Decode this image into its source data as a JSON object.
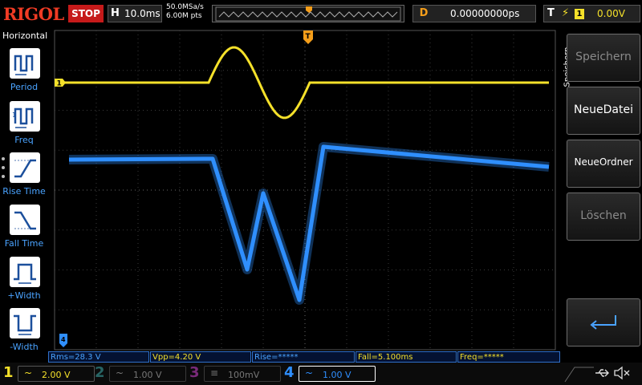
{
  "topbar": {
    "logo": "RIGOL",
    "run_state": "STOP",
    "horizontal_letter": "H",
    "timebase": "10.0ms",
    "sample_rate": "50.0MSa/s",
    "memory_depth": "6.00M pts",
    "delay_letter": "D",
    "delay": "0.00000000ps",
    "trigger_letter": "T",
    "trigger_edge": "⚡",
    "trigger_source": "1",
    "trigger_level": "0.00V"
  },
  "left_menu": {
    "title": "Horizontal",
    "items": [
      {
        "label": "Period",
        "icon": "period-icon"
      },
      {
        "label": "Freq",
        "icon": "freq-icon"
      },
      {
        "label": "Rise Time",
        "icon": "rise-time-icon"
      },
      {
        "label": "Fall Time",
        "icon": "fall-time-icon"
      },
      {
        "label": "+Width",
        "icon": "positive-width-icon"
      },
      {
        "label": "-Width",
        "icon": "negative-width-icon"
      }
    ]
  },
  "right_menu": {
    "tab": "Speichern",
    "buttons": [
      {
        "label": "Speichern",
        "enabled": false
      },
      {
        "label": "NeueDatei",
        "enabled": true
      },
      {
        "label": "NeueOrdner",
        "enabled": true
      },
      {
        "label": "Löschen",
        "enabled": false
      }
    ],
    "return_icon": "return-arrow-icon"
  },
  "markers": {
    "ch1": "1",
    "trigger_pos": "T",
    "ch4": "4"
  },
  "measurements": [
    {
      "text": "Rms=28.3 V",
      "color": "blue"
    },
    {
      "text": "Vpp=4.20 V",
      "color": "yellow"
    },
    {
      "text": "Rise=*****",
      "color": "blue"
    },
    {
      "text": "Fall=5.100ms",
      "color": "yellow"
    },
    {
      "text": "Freq=*****",
      "color": "yellow"
    }
  ],
  "channels": [
    {
      "num": "1",
      "coupling": "~",
      "scale": "2.00 V",
      "color": "#f5e12a",
      "on": true
    },
    {
      "num": "2",
      "coupling": "~",
      "scale": "1.00 V",
      "color": "#3aa0a0",
      "on": false
    },
    {
      "num": "3",
      "coupling": "≡",
      "scale": "100mV",
      "color": "#c43fc4",
      "on": false
    },
    {
      "num": "4",
      "coupling": "~",
      "scale": "1.00 V",
      "color": "#2f8fff",
      "on": true
    }
  ],
  "status": {
    "usb_icon": "usb-icon",
    "mute_icon": "speaker-mute-icon"
  },
  "colors": {
    "ch1": "#f5e12a",
    "ch4": "#2f8fff",
    "trigger": "#f59e1a",
    "stop": "#c61a1a"
  }
}
